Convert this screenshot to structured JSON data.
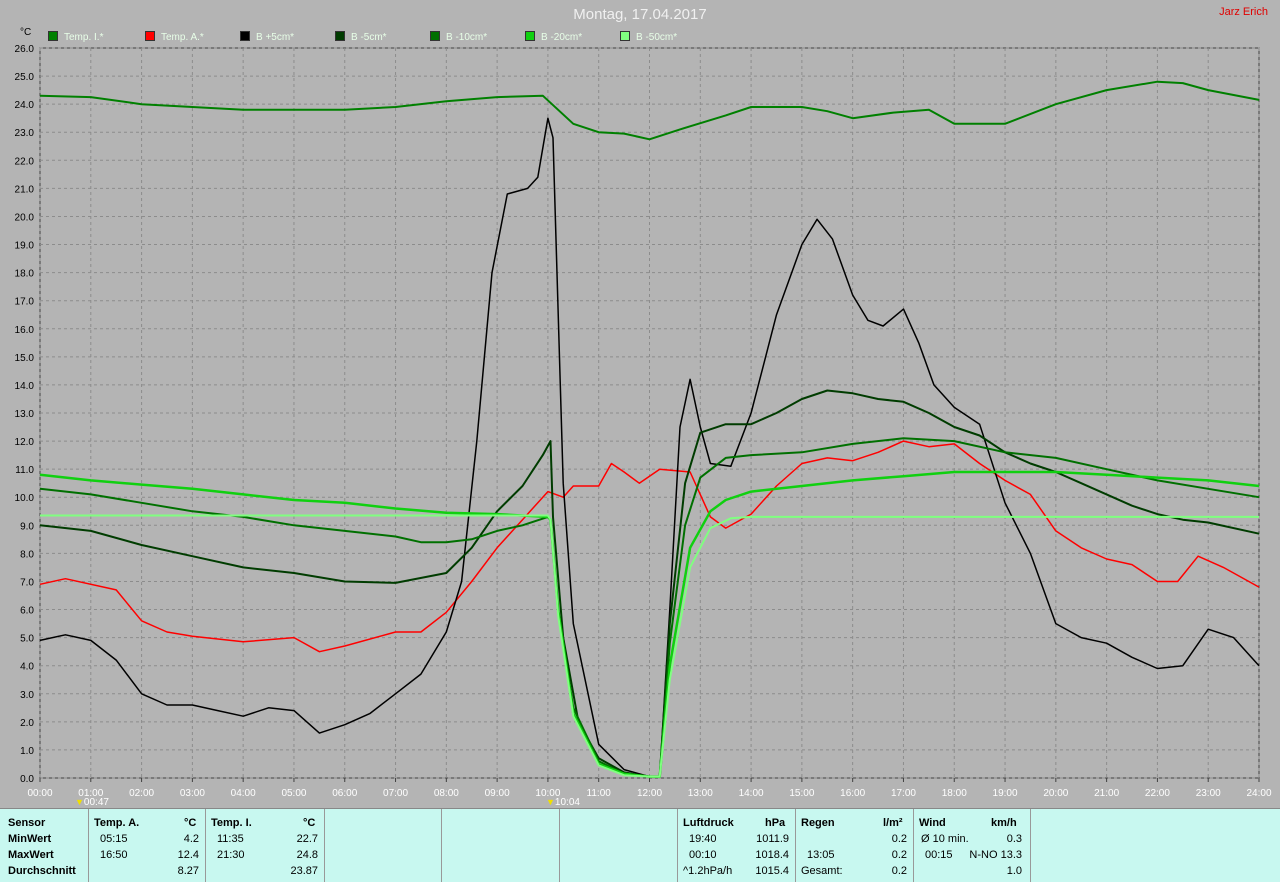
{
  "title": "Montag, 17.04.2017",
  "author": "Jarz Erich",
  "y_unit": "°C",
  "markers": [
    {
      "label": "00:47",
      "x": 0.78
    },
    {
      "label": "10:04",
      "x": 10.07
    }
  ],
  "colors": {
    "background": "#b4b4b4",
    "grid": "#8c8c8c",
    "panel": "#c8f8f0"
  },
  "chart_data": {
    "type": "line",
    "xlabel": "",
    "ylabel": "°C",
    "xlim": [
      0,
      24
    ],
    "ylim": [
      0,
      26
    ],
    "x_ticks": [
      "00:00",
      "01:00",
      "02:00",
      "03:00",
      "04:00",
      "05:00",
      "06:00",
      "07:00",
      "08:00",
      "09:00",
      "10:00",
      "11:00",
      "12:00",
      "13:00",
      "14:00",
      "15:00",
      "16:00",
      "17:00",
      "18:00",
      "19:00",
      "20:00",
      "21:00",
      "22:00",
      "23:00",
      "24:00"
    ],
    "y_ticks": [
      "0.0",
      "1.0",
      "2.0",
      "3.0",
      "4.0",
      "5.0",
      "6.0",
      "7.0",
      "8.0",
      "9.0",
      "10.0",
      "11.0",
      "12.0",
      "13.0",
      "14.0",
      "15.0",
      "16.0",
      "17.0",
      "18.0",
      "19.0",
      "20.0",
      "21.0",
      "22.0",
      "23.0",
      "24.0",
      "25.0",
      "26.0"
    ],
    "grid": true,
    "legend_position": "top",
    "series": [
      {
        "name": "Temp. I.*",
        "color": "#008000",
        "width": 2,
        "points": [
          [
            0,
            24.3
          ],
          [
            1,
            24.25
          ],
          [
            2,
            24.0
          ],
          [
            3,
            23.9
          ],
          [
            4,
            23.8
          ],
          [
            5,
            23.8
          ],
          [
            6,
            23.8
          ],
          [
            7,
            23.9
          ],
          [
            8,
            24.1
          ],
          [
            9,
            24.25
          ],
          [
            9.9,
            24.3
          ],
          [
            10.5,
            23.3
          ],
          [
            11,
            23.0
          ],
          [
            11.5,
            22.95
          ],
          [
            12,
            22.75
          ],
          [
            12.6,
            23.1
          ],
          [
            13.5,
            23.6
          ],
          [
            14,
            23.9
          ],
          [
            15,
            23.9
          ],
          [
            15.5,
            23.75
          ],
          [
            16,
            23.5
          ],
          [
            16.8,
            23.7
          ],
          [
            17.5,
            23.8
          ],
          [
            18,
            23.3
          ],
          [
            19,
            23.3
          ],
          [
            20,
            24.0
          ],
          [
            21,
            24.5
          ],
          [
            22,
            24.8
          ],
          [
            22.5,
            24.75
          ],
          [
            23,
            24.5
          ],
          [
            24,
            24.15
          ]
        ]
      },
      {
        "name": "Temp. A.*",
        "color": "#ff0000",
        "width": 1.5,
        "points": [
          [
            0,
            6.9
          ],
          [
            0.5,
            7.1
          ],
          [
            1.5,
            6.7
          ],
          [
            2,
            5.6
          ],
          [
            2.5,
            5.2
          ],
          [
            3,
            5.05
          ],
          [
            4,
            4.85
          ],
          [
            5,
            5.0
          ],
          [
            5.5,
            4.5
          ],
          [
            6,
            4.7
          ],
          [
            7,
            5.2
          ],
          [
            7.5,
            5.2
          ],
          [
            8,
            5.9
          ],
          [
            8.5,
            7.0
          ],
          [
            9,
            8.2
          ],
          [
            9.5,
            9.2
          ],
          [
            10,
            10.2
          ],
          [
            10.3,
            10.0
          ],
          [
            10.5,
            10.4
          ],
          [
            11,
            10.4
          ],
          [
            11.25,
            11.2
          ],
          [
            11.5,
            10.9
          ],
          [
            11.8,
            10.5
          ],
          [
            12.2,
            11.0
          ],
          [
            12.8,
            10.9
          ],
          [
            13.2,
            9.3
          ],
          [
            13.5,
            8.9
          ],
          [
            14,
            9.4
          ],
          [
            14.5,
            10.4
          ],
          [
            15,
            11.2
          ],
          [
            15.5,
            11.4
          ],
          [
            16,
            11.3
          ],
          [
            16.5,
            11.6
          ],
          [
            17,
            12.0
          ],
          [
            17.5,
            11.8
          ],
          [
            18,
            11.9
          ],
          [
            18.5,
            11.2
          ],
          [
            19,
            10.6
          ],
          [
            19.5,
            10.1
          ],
          [
            20,
            8.8
          ],
          [
            20.5,
            8.2
          ],
          [
            21,
            7.8
          ],
          [
            21.5,
            7.6
          ],
          [
            22,
            7.0
          ],
          [
            22.4,
            7.0
          ],
          [
            22.8,
            7.9
          ],
          [
            23.3,
            7.5
          ],
          [
            24,
            6.8
          ]
        ]
      },
      {
        "name": "B +5cm*",
        "color": "#000000",
        "width": 1.5,
        "points": [
          [
            0,
            4.9
          ],
          [
            0.5,
            5.1
          ],
          [
            1,
            4.9
          ],
          [
            1.5,
            4.2
          ],
          [
            2,
            3.0
          ],
          [
            2.5,
            2.6
          ],
          [
            3,
            2.6
          ],
          [
            3.5,
            2.4
          ],
          [
            4,
            2.2
          ],
          [
            4.5,
            2.5
          ],
          [
            5,
            2.4
          ],
          [
            5.5,
            1.6
          ],
          [
            6,
            1.9
          ],
          [
            6.5,
            2.3
          ],
          [
            7,
            3.0
          ],
          [
            7.5,
            3.7
          ],
          [
            8,
            5.2
          ],
          [
            8.3,
            7.0
          ],
          [
            8.6,
            12.0
          ],
          [
            8.9,
            18.0
          ],
          [
            9.2,
            20.8
          ],
          [
            9.6,
            21.0
          ],
          [
            9.8,
            21.4
          ],
          [
            10,
            23.5
          ],
          [
            10.1,
            22.8
          ],
          [
            10.3,
            10.5
          ],
          [
            10.5,
            5.5
          ],
          [
            11,
            1.2
          ],
          [
            11.5,
            0.3
          ],
          [
            12,
            0.05
          ],
          [
            12.2,
            0.05
          ],
          [
            12.4,
            6.0
          ],
          [
            12.6,
            12.5
          ],
          [
            12.8,
            14.2
          ],
          [
            13.0,
            12.5
          ],
          [
            13.2,
            11.2
          ],
          [
            13.6,
            11.1
          ],
          [
            14,
            13.0
          ],
          [
            14.5,
            16.5
          ],
          [
            15,
            19.0
          ],
          [
            15.3,
            19.9
          ],
          [
            15.6,
            19.2
          ],
          [
            16,
            17.2
          ],
          [
            16.3,
            16.3
          ],
          [
            16.6,
            16.1
          ],
          [
            17,
            16.7
          ],
          [
            17.3,
            15.5
          ],
          [
            17.6,
            14.0
          ],
          [
            18,
            13.2
          ],
          [
            18.5,
            12.6
          ],
          [
            19,
            9.8
          ],
          [
            19.5,
            8.0
          ],
          [
            20,
            5.5
          ],
          [
            20.5,
            5.0
          ],
          [
            21,
            4.8
          ],
          [
            21.5,
            4.3
          ],
          [
            22,
            3.9
          ],
          [
            22.5,
            4.0
          ],
          [
            23,
            5.3
          ],
          [
            23.5,
            5.0
          ],
          [
            24,
            4.0
          ]
        ]
      },
      {
        "name": "B -5cm*",
        "color": "#003c00",
        "width": 2,
        "points": [
          [
            0,
            9.0
          ],
          [
            1,
            8.8
          ],
          [
            2,
            8.3
          ],
          [
            3,
            7.9
          ],
          [
            4,
            7.5
          ],
          [
            5,
            7.3
          ],
          [
            6,
            7.0
          ],
          [
            7,
            6.95
          ],
          [
            8,
            7.3
          ],
          [
            8.5,
            8.2
          ],
          [
            9,
            9.5
          ],
          [
            9.5,
            10.4
          ],
          [
            9.9,
            11.5
          ],
          [
            10.05,
            12.0
          ],
          [
            10.1,
            9.3
          ],
          [
            10.3,
            5.0
          ],
          [
            10.6,
            2.0
          ],
          [
            11,
            0.7
          ],
          [
            11.5,
            0.2
          ],
          [
            12,
            0.05
          ],
          [
            12.2,
            0.05
          ],
          [
            12.4,
            5.5
          ],
          [
            12.7,
            10.5
          ],
          [
            13,
            12.3
          ],
          [
            13.5,
            12.6
          ],
          [
            14,
            12.6
          ],
          [
            14.5,
            13.0
          ],
          [
            15,
            13.5
          ],
          [
            15.5,
            13.8
          ],
          [
            16,
            13.7
          ],
          [
            16.5,
            13.5
          ],
          [
            17,
            13.4
          ],
          [
            17.5,
            13.0
          ],
          [
            18,
            12.5
          ],
          [
            18.5,
            12.2
          ],
          [
            19,
            11.6
          ],
          [
            19.5,
            11.2
          ],
          [
            20,
            10.9
          ],
          [
            20.5,
            10.5
          ],
          [
            21,
            10.1
          ],
          [
            21.5,
            9.7
          ],
          [
            22,
            9.4
          ],
          [
            22.5,
            9.2
          ],
          [
            23,
            9.1
          ],
          [
            24,
            8.7
          ]
        ]
      },
      {
        "name": "B -10cm*",
        "color": "#007000",
        "width": 2,
        "points": [
          [
            0,
            10.3
          ],
          [
            1,
            10.1
          ],
          [
            2,
            9.8
          ],
          [
            3,
            9.5
          ],
          [
            4,
            9.3
          ],
          [
            5,
            9.0
          ],
          [
            6,
            8.8
          ],
          [
            7,
            8.6
          ],
          [
            7.5,
            8.4
          ],
          [
            8,
            8.4
          ],
          [
            8.5,
            8.5
          ],
          [
            9,
            8.8
          ],
          [
            9.5,
            9.0
          ],
          [
            10,
            9.3
          ],
          [
            10.05,
            9.2
          ],
          [
            10.2,
            6.0
          ],
          [
            10.5,
            2.5
          ],
          [
            11,
            0.6
          ],
          [
            11.5,
            0.15
          ],
          [
            12,
            0.05
          ],
          [
            12.2,
            0.05
          ],
          [
            12.4,
            4.8
          ],
          [
            12.7,
            9.0
          ],
          [
            13,
            10.7
          ],
          [
            13.5,
            11.4
          ],
          [
            14,
            11.5
          ],
          [
            15,
            11.6
          ],
          [
            16,
            11.9
          ],
          [
            17,
            12.1
          ],
          [
            18,
            12.0
          ],
          [
            19,
            11.6
          ],
          [
            20,
            11.4
          ],
          [
            21,
            11.0
          ],
          [
            22,
            10.6
          ],
          [
            23,
            10.3
          ],
          [
            24,
            10.0
          ]
        ]
      },
      {
        "name": "B -20cm*",
        "color": "#10d010",
        "width": 2.5,
        "points": [
          [
            0,
            10.8
          ],
          [
            1,
            10.6
          ],
          [
            2,
            10.45
          ],
          [
            3,
            10.3
          ],
          [
            4,
            10.1
          ],
          [
            5,
            9.9
          ],
          [
            6,
            9.8
          ],
          [
            7,
            9.6
          ],
          [
            8,
            9.45
          ],
          [
            9,
            9.4
          ],
          [
            10,
            9.3
          ],
          [
            10.05,
            9.2
          ],
          [
            10.2,
            6.0
          ],
          [
            10.5,
            2.3
          ],
          [
            11,
            0.5
          ],
          [
            11.5,
            0.15
          ],
          [
            12,
            0.05
          ],
          [
            12.2,
            0.05
          ],
          [
            12.4,
            4.0
          ],
          [
            12.8,
            8.2
          ],
          [
            13.2,
            9.5
          ],
          [
            13.5,
            9.9
          ],
          [
            14,
            10.2
          ],
          [
            15,
            10.4
          ],
          [
            16,
            10.6
          ],
          [
            17,
            10.75
          ],
          [
            18,
            10.9
          ],
          [
            19,
            10.9
          ],
          [
            20,
            10.9
          ],
          [
            21,
            10.8
          ],
          [
            22,
            10.7
          ],
          [
            23,
            10.6
          ],
          [
            24,
            10.4
          ]
        ]
      },
      {
        "name": "B -50cm*",
        "color": "#80ff80",
        "width": 2,
        "points": [
          [
            0,
            9.35
          ],
          [
            2,
            9.35
          ],
          [
            4,
            9.35
          ],
          [
            6,
            9.35
          ],
          [
            8,
            9.35
          ],
          [
            10,
            9.35
          ],
          [
            10.05,
            9.2
          ],
          [
            10.2,
            5.8
          ],
          [
            10.5,
            2.2
          ],
          [
            11,
            0.45
          ],
          [
            11.5,
            0.1
          ],
          [
            12,
            0.05
          ],
          [
            12.2,
            0.05
          ],
          [
            12.4,
            3.5
          ],
          [
            12.8,
            7.5
          ],
          [
            13.2,
            8.9
          ],
          [
            13.6,
            9.25
          ],
          [
            14,
            9.3
          ],
          [
            16,
            9.3
          ],
          [
            18,
            9.3
          ],
          [
            20,
            9.3
          ],
          [
            22,
            9.3
          ],
          [
            24,
            9.3
          ]
        ]
      }
    ]
  },
  "stats": {
    "sensor_label": "Sensor",
    "row_labels": [
      "MinWert",
      "MaxWert",
      "Durchschnitt"
    ],
    "temp_a": {
      "header": "Temp. A.",
      "unit": "°C",
      "min_time": "05:15",
      "min": "4.2",
      "max_time": "16:50",
      "max": "12.4",
      "avg": "8.27"
    },
    "temp_i": {
      "header": "Temp. I.",
      "unit": "°C",
      "min_time": "11:35",
      "min": "22.7",
      "max_time": "21:30",
      "max": "24.8",
      "avg": "23.87"
    },
    "pressure": {
      "header": "Luftdruck",
      "unit": "hPa",
      "min_time": "19:40",
      "min": "1011.9",
      "max_time": "00:10",
      "max": "1018.4",
      "trend_label": "^1.2hPa/h",
      "avg": "1015.4"
    },
    "rain": {
      "header": "Regen",
      "unit": "l/m²",
      "r1_val": "0.2",
      "r2_time": "13:05",
      "r2_val": "0.2",
      "total_label": "Gesamt:",
      "total": "0.2"
    },
    "wind": {
      "header": "Wind",
      "unit": "km/h",
      "r1_label": "Ø 10 min.",
      "r1_val": "0.3",
      "r2_time": "00:15",
      "r2_val": "N-NO 13.3",
      "r3_val": "1.0"
    }
  }
}
